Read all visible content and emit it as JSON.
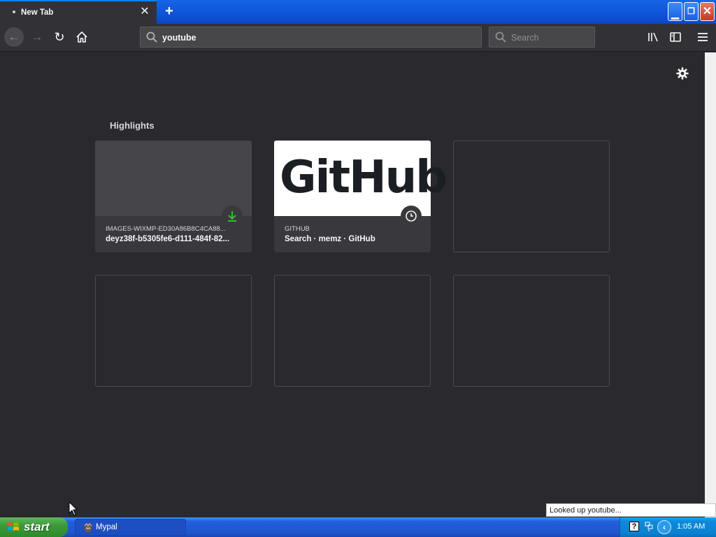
{
  "window": {
    "tab_title": "New Tab",
    "tab_close_icon": "close-icon",
    "new_tab_icon": "plus-icon"
  },
  "toolbar": {
    "url_value": "youtube",
    "search_placeholder": "Search"
  },
  "content": {
    "section_title": "Highlights",
    "cards": [
      {
        "host": "IMAGES-WIXMP-ED30A86B8C4CA88...",
        "title": "deyz38f-b5305fe6-d111-484f-82...",
        "badge_icon": "download-icon"
      },
      {
        "host": "GITHUB",
        "title": "Search · memz · GitHub",
        "thumb_text": "GitHub",
        "badge_icon": "clock-icon"
      }
    ]
  },
  "status": {
    "tooltip": "Looked up youtube..."
  },
  "taskbar": {
    "start_label": "start",
    "task_label": "Mypal",
    "clock": "1:05 AM",
    "help_glyph": "?"
  },
  "colors": {
    "accent": "#0a84ff",
    "content_bg": "#2a2a2e",
    "toolbar_bg": "#323236",
    "download_green": "#30c030"
  }
}
